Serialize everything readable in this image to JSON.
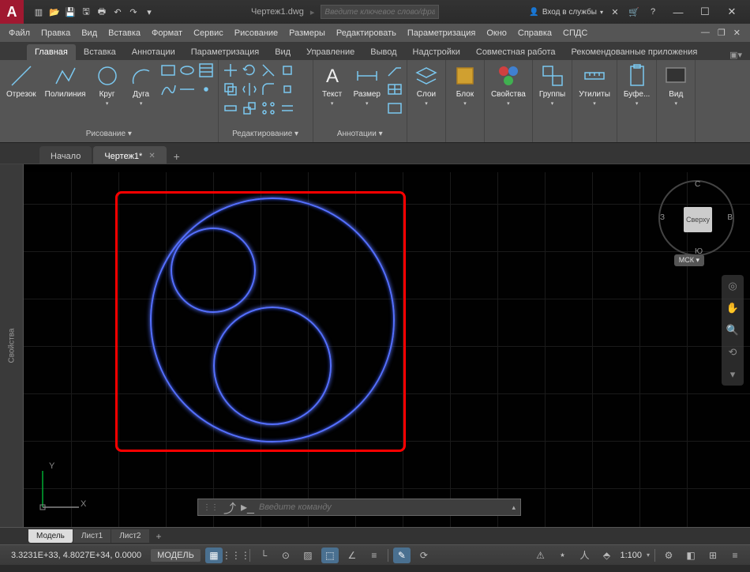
{
  "titlebar": {
    "doc_title": "Чертеж1.dwg",
    "search_placeholder": "Введите ключевое слово/фразу",
    "login_label": "Вход в службы"
  },
  "window_controls": {
    "min": "—",
    "max": "☐",
    "close": "✕"
  },
  "menubar": {
    "items": [
      "Файл",
      "Правка",
      "Вид",
      "Вставка",
      "Формат",
      "Сервис",
      "Рисование",
      "Размеры",
      "Редактировать",
      "Параметризация",
      "Окно",
      "Справка",
      "СПДС"
    ]
  },
  "ribbon_tabs": {
    "items": [
      "Главная",
      "Вставка",
      "Аннотации",
      "Параметризация",
      "Вид",
      "Управление",
      "Вывод",
      "Надстройки",
      "Совместная работа",
      "Рекомендованные приложения"
    ],
    "active": 0
  },
  "ribbon": {
    "draw": {
      "title": "Рисование ▾",
      "line": "Отрезок",
      "polyline": "Полилиния",
      "circle": "Круг",
      "arc": "Дуга"
    },
    "modify": {
      "title": "Редактирование ▾"
    },
    "annot": {
      "title": "Аннотации ▾",
      "text": "Текст",
      "dim": "Размер"
    },
    "layers": {
      "title": "",
      "btn": "Слои"
    },
    "block": {
      "title": "",
      "btn": "Блок"
    },
    "props": {
      "title": "",
      "btn": "Свойства"
    },
    "groups": {
      "title": "",
      "btn": "Группы"
    },
    "utils": {
      "title": "",
      "btn": "Утилиты"
    },
    "clip": {
      "title": "",
      "btn": "Буфе..."
    },
    "view": {
      "title": "",
      "btn": "Вид"
    }
  },
  "filetabs": {
    "items": [
      {
        "label": "Начало",
        "closable": false
      },
      {
        "label": "Чертеж1*",
        "closable": true
      }
    ],
    "active": 1
  },
  "sidebar": {
    "properties": "Свойства"
  },
  "viewcube": {
    "face": "Сверху",
    "n": "С",
    "s": "Ю",
    "e": "В",
    "w": "З",
    "wcs": "МСК"
  },
  "ucs": {
    "x": "X",
    "y": "Y"
  },
  "cmdline": {
    "placeholder": "Введите команду"
  },
  "layouts": {
    "items": [
      "Модель",
      "Лист1",
      "Лист2"
    ],
    "active": 0
  },
  "statusbar": {
    "coords": "3.3231E+33, 4.8027E+34, 0.0000",
    "model": "МОДЕЛЬ",
    "scale": "1:100"
  }
}
